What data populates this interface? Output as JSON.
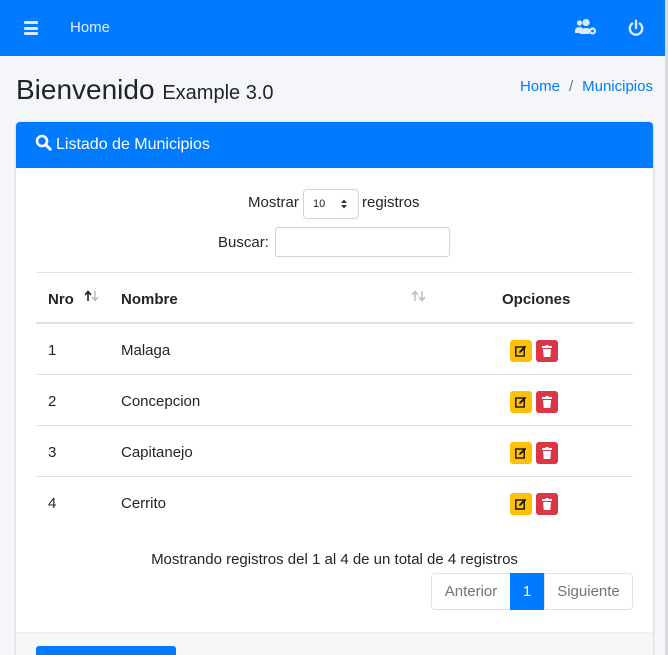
{
  "colors": {
    "primary": "#007bff",
    "warning": "#ffc107",
    "danger": "#dc3545",
    "background": "#f4f6f9"
  },
  "navbar": {
    "home_label": "Home",
    "icons": [
      "bars-icon",
      "users-cog-icon",
      "power-icon"
    ]
  },
  "header": {
    "title": "Bienvenido",
    "subtitle": "Example 3.0",
    "breadcrumb": [
      {
        "label": "Home"
      },
      {
        "separator": "/"
      },
      {
        "label": "Municipios"
      }
    ]
  },
  "card": {
    "title": "Listado de Municipios",
    "length": {
      "prefix": "Mostrar",
      "value": "10",
      "suffix": "registros"
    },
    "search": {
      "label": "Buscar:",
      "value": ""
    },
    "columns": [
      "Nro",
      "Nombre",
      "Opciones"
    ],
    "rows": [
      {
        "nro": "1",
        "nombre": "Malaga"
      },
      {
        "nro": "2",
        "nombre": "Concepcion"
      },
      {
        "nro": "3",
        "nombre": "Capitanejo"
      },
      {
        "nro": "4",
        "nombre": "Cerrito"
      }
    ],
    "info": "Mostrando registros del 1 al 4 de un total de 4 registros",
    "pagination": {
      "prev": "Anterior",
      "current": "1",
      "next": "Siguiente"
    }
  }
}
